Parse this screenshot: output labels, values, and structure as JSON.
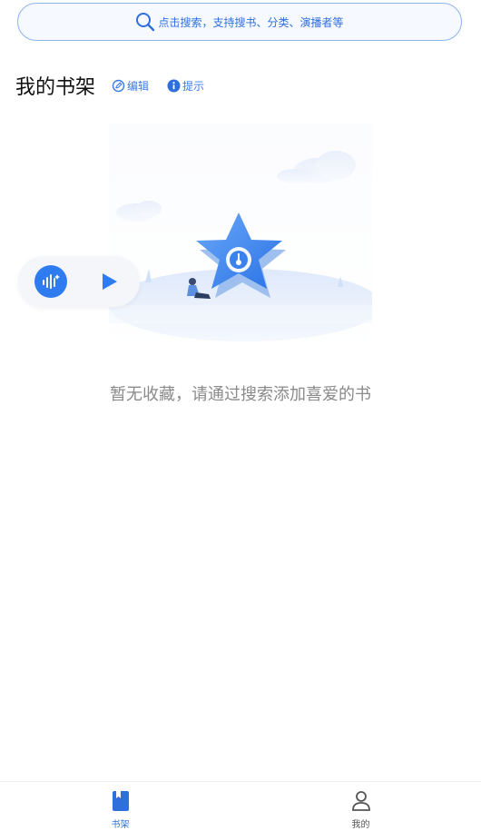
{
  "search": {
    "placeholder": "点击搜索，支持搜书、分类、演播者等"
  },
  "header": {
    "title": "我的书架",
    "edit_label": "编辑",
    "tip_label": "提示"
  },
  "empty_state": {
    "message": "暂无收藏，请通过搜索添加喜爱的书"
  },
  "bottom_nav": {
    "items": [
      {
        "label": "书架",
        "icon": "bookshelf-icon",
        "active": true
      },
      {
        "label": "我的",
        "icon": "person-icon",
        "active": false
      }
    ]
  },
  "colors": {
    "accent": "#2f6fdc",
    "search_border": "#8db4e8",
    "empty_text": "#8a8a8a"
  }
}
